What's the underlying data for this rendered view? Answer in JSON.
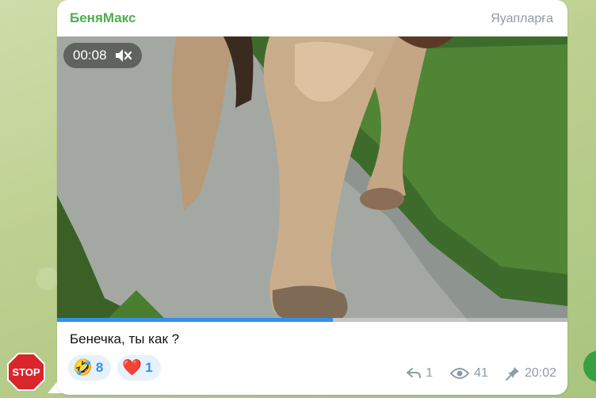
{
  "message": {
    "sender": "БеняМакс",
    "reply_label": "Яуапларға",
    "caption": "Бенечка, ты как ?",
    "video": {
      "timestamp": "00:08",
      "progress": 0.54,
      "muted_icon": "speaker-muted-icon"
    },
    "reactions": [
      {
        "emoji": "🤣",
        "count": "8",
        "icon": "rofl-emoji-icon"
      },
      {
        "emoji": "❤️",
        "count": "1",
        "icon": "heart-emoji-icon"
      }
    ],
    "meta": {
      "replies": "1",
      "views": "41",
      "time": "20:02"
    }
  },
  "sticker": {
    "label": "STOP"
  },
  "colors": {
    "sender": "#4fae4e",
    "accent": "#3390ec",
    "meta": "#8e9aa6"
  }
}
